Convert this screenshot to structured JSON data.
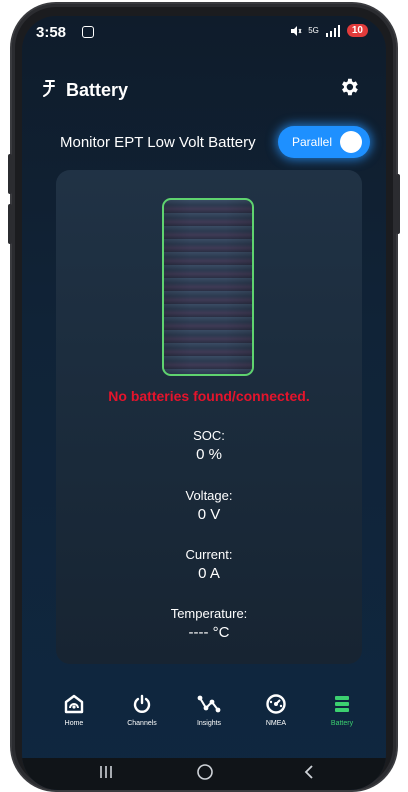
{
  "status_bar": {
    "time": "3:58",
    "battery_level": "10",
    "network": "5G"
  },
  "header": {
    "title": "Battery",
    "logo_icon": "plug-icon",
    "settings_icon": "gear-icon"
  },
  "monitor": {
    "label": "Monitor EPT Low Volt Battery",
    "toggle_label": "Parallel",
    "toggle_on": true
  },
  "card": {
    "error": "No batteries found/connected.",
    "stats": [
      {
        "label": "SOC:",
        "value": "0 %"
      },
      {
        "label": "Voltage:",
        "value": "0 V"
      },
      {
        "label": "Current:",
        "value": "0 A"
      },
      {
        "label": "Temperature:",
        "value": "---- °C"
      }
    ]
  },
  "nav": {
    "items": [
      {
        "label": "Home",
        "icon": "home-icon"
      },
      {
        "label": "Channels",
        "icon": "power-icon"
      },
      {
        "label": "Insights",
        "icon": "insights-icon"
      },
      {
        "label": "NMEA",
        "icon": "gauge-icon"
      },
      {
        "label": "Battery",
        "icon": "battery-stack-icon",
        "active": true
      }
    ]
  },
  "colors": {
    "accent": "#1e90ff",
    "active_nav": "#3cd070",
    "error": "#e5142c",
    "battery_outline": "#5fd36f"
  }
}
